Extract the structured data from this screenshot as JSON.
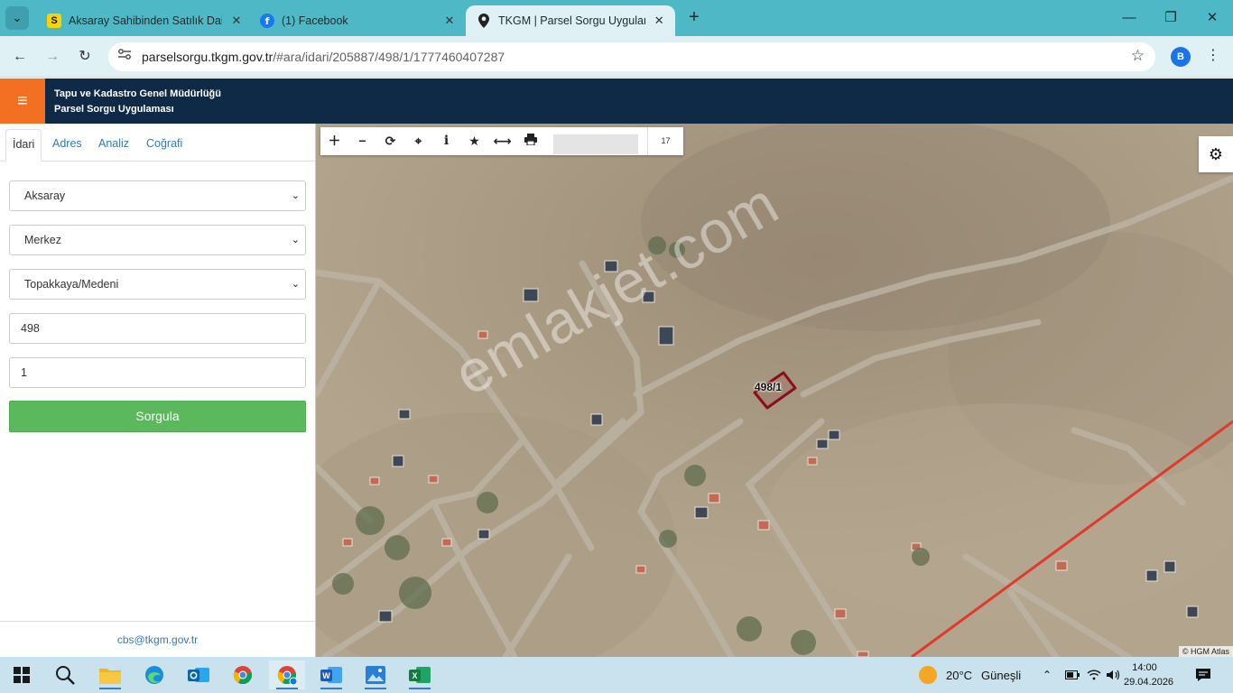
{
  "browser": {
    "tabs": [
      {
        "title": "Aksaray Sahibinden Satılık Daire",
        "favicon": "S",
        "active": false
      },
      {
        "title": "(1) Facebook",
        "favicon": "f",
        "active": false
      },
      {
        "title": "TKGM | Parsel Sorgu Uygulaması",
        "favicon": "map-pin",
        "active": true
      }
    ],
    "url_host": "parselsorgu.tkgm.gov.tr",
    "url_path": "/#ara/idari/205887/498/1/1777460407287",
    "profile_initial": "B"
  },
  "app": {
    "org_name": "Tapu ve Kadastro Genel Müdürlüğü",
    "app_name": "Parsel Sorgu Uygulaması"
  },
  "sidebar": {
    "tabs": [
      "İdari",
      "Adres",
      "Analiz",
      "Coğrafi"
    ],
    "active_tab": "İdari",
    "province": "Aksaray",
    "district": "Merkez",
    "neighborhood": "Topakkaya/Medeni",
    "block_no": "498",
    "parcel_no": "1",
    "query_button": "Sorgula",
    "contact_email": "cbs@tkgm.gov.tr"
  },
  "map": {
    "zoom_level": "17",
    "parcel_label": "498/1",
    "watermark": "emlakjet.com",
    "attribution": "© HGM Atlas"
  },
  "taskbar": {
    "weather_temp": "20°C",
    "weather_text": "Güneşli",
    "time": "14:00",
    "date": "29.04.2026"
  },
  "colors": {
    "tab_strip": "#4fb8c6",
    "app_header": "#0e2a47",
    "menu_accent": "#f36f21",
    "query_button": "#5cb85c",
    "link": "#337ab7",
    "parcel_outline": "#8b0e1e"
  }
}
